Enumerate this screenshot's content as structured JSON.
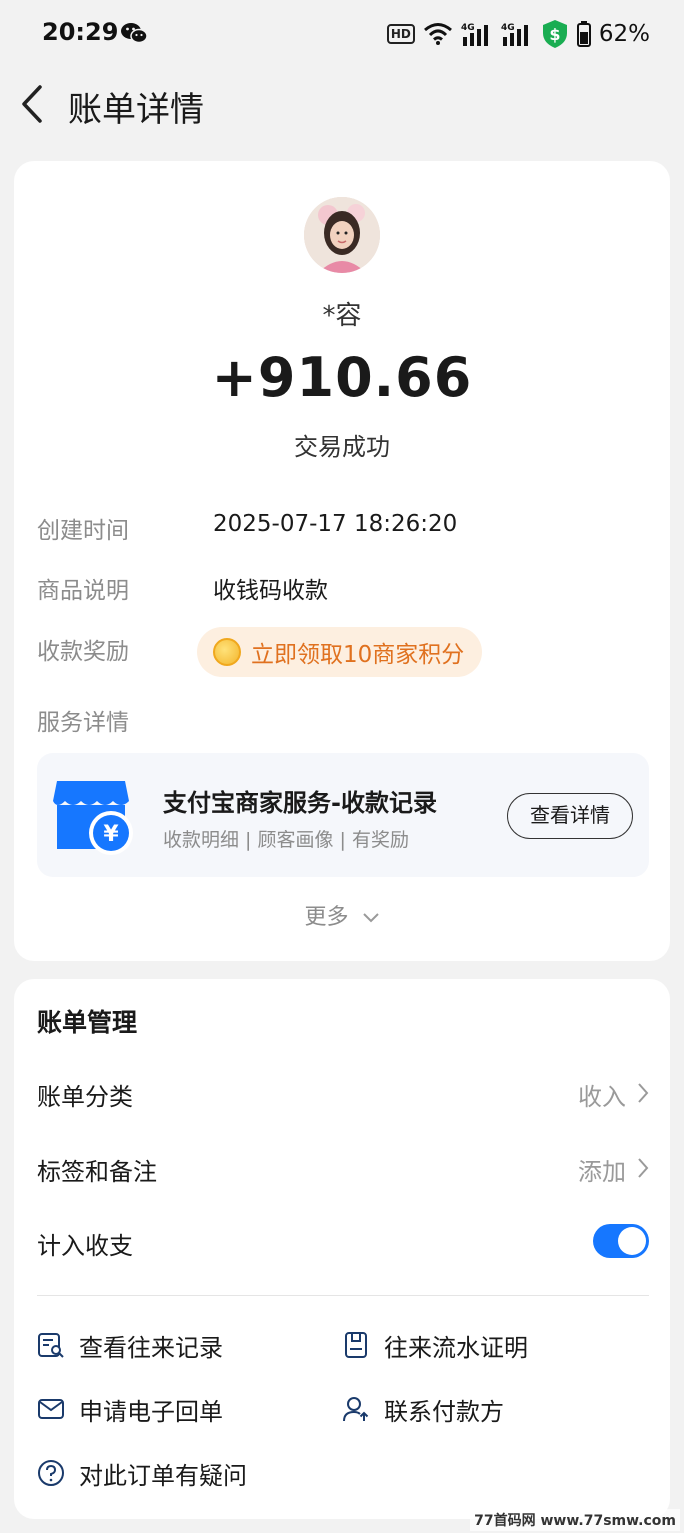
{
  "status_bar": {
    "time": "20:29",
    "hd_badge": "HD",
    "battery": "62%",
    "icons": [
      "wechat-icon",
      "hd-icon",
      "wifi-icon",
      "signal-4g-icon",
      "signal-4g-icon",
      "shield-icon",
      "battery-icon"
    ]
  },
  "nav": {
    "title": "账单详情",
    "back_icon": "chevron-left-icon"
  },
  "transaction": {
    "payer": "*容",
    "amount": "+910.66",
    "status": "交易成功",
    "created_label": "创建时间",
    "created_value": "2025-07-17 18:26:20",
    "product_label": "商品说明",
    "product_value": "收钱码收款",
    "reward_label": "收款奖励",
    "reward_text": "立即领取10商家积分",
    "service_label": "服务详情"
  },
  "service": {
    "title": "支付宝商家服务-收款记录",
    "subtitle": "收款明细 | 顾客画像 | 有奖励",
    "button": "查看详情",
    "more": "更多"
  },
  "management": {
    "title": "账单管理",
    "category_label": "账单分类",
    "category_value": "收入",
    "tags_label": "标签和备注",
    "tags_value": "添加",
    "count_label": "计入收支",
    "count_enabled": true
  },
  "actions": {
    "view_records": "查看往来记录",
    "flow_proof": "往来流水证明",
    "e_receipt": "申请电子回单",
    "contact_payer": "联系付款方",
    "question": "对此订单有疑问"
  },
  "colors": {
    "accent": "#1677ff",
    "reward": "#e0711f",
    "reward_bg": "#fdefe0",
    "background": "#f2f2f2"
  },
  "watermark": "77首码网 www.77smw.com"
}
